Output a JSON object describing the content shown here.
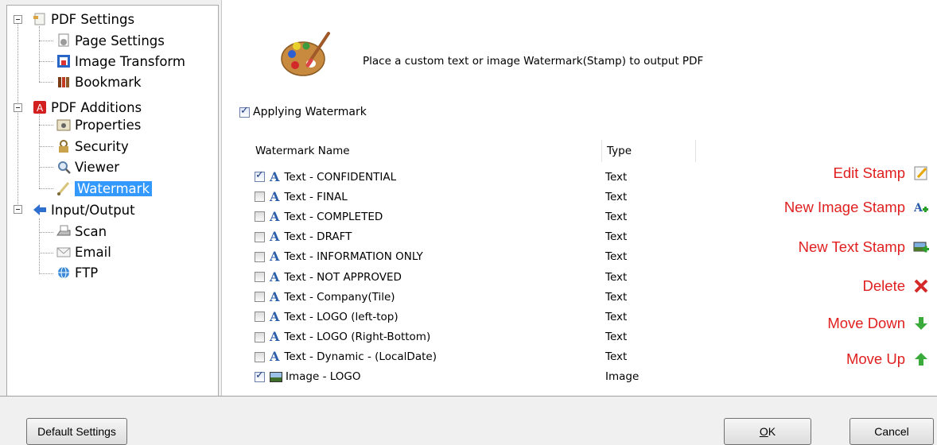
{
  "tree": {
    "items": [
      {
        "label": "PDF Settings",
        "icon": "pdf-settings-icon"
      },
      {
        "label": "Page Settings",
        "icon": "page-settings-icon"
      },
      {
        "label": "Image Transform",
        "icon": "image-transform-icon"
      },
      {
        "label": "Bookmark",
        "icon": "bookmark-icon"
      },
      {
        "label": "PDF Additions",
        "icon": "pdf-additions-icon"
      },
      {
        "label": "Properties",
        "icon": "properties-icon"
      },
      {
        "label": "Security",
        "icon": "security-icon"
      },
      {
        "label": "Viewer",
        "icon": "viewer-icon"
      },
      {
        "label": "Watermark",
        "icon": "watermark-icon",
        "selected": true
      },
      {
        "label": "Input/Output",
        "icon": "input-output-icon"
      },
      {
        "label": "Scan",
        "icon": "scan-icon"
      },
      {
        "label": "Email",
        "icon": "email-icon"
      },
      {
        "label": "FTP",
        "icon": "ftp-icon"
      }
    ]
  },
  "header": {
    "description": "Place a custom text or image Watermark(Stamp) to output PDF"
  },
  "apply": {
    "label": "Applying Watermark",
    "checked": true
  },
  "table": {
    "columns": [
      "Watermark Name",
      "Type"
    ],
    "rows": [
      {
        "name": "Text - CONFIDENTIAL",
        "type": "Text",
        "checked": true,
        "kind": "text"
      },
      {
        "name": "Text - FINAL",
        "type": "Text",
        "checked": false,
        "kind": "text"
      },
      {
        "name": "Text - COMPLETED",
        "type": "Text",
        "checked": false,
        "kind": "text"
      },
      {
        "name": "Text - DRAFT",
        "type": "Text",
        "checked": false,
        "kind": "text"
      },
      {
        "name": "Text - INFORMATION ONLY",
        "type": "Text",
        "checked": false,
        "kind": "text"
      },
      {
        "name": "Text - NOT APPROVED",
        "type": "Text",
        "checked": false,
        "kind": "text"
      },
      {
        "name": "Text - Company(Tile)",
        "type": "Text",
        "checked": false,
        "kind": "text"
      },
      {
        "name": "Text - LOGO (left-top)",
        "type": "Text",
        "checked": false,
        "kind": "text"
      },
      {
        "name": "Text - LOGO (Right-Bottom)",
        "type": "Text",
        "checked": false,
        "kind": "text"
      },
      {
        "name": "Text - Dynamic - (LocalDate)",
        "type": "Text",
        "checked": false,
        "kind": "text"
      },
      {
        "name": "Image - LOGO",
        "type": "Image",
        "checked": true,
        "kind": "image"
      }
    ]
  },
  "actions": {
    "edit": "Edit Stamp",
    "new_image": "New Image Stamp",
    "new_text": "New Text Stamp",
    "delete": "Delete",
    "move_down": "Move Down",
    "move_up": "Move Up"
  },
  "buttons": {
    "default": "Default Settings",
    "ok_u": "O",
    "ok_rest": "K",
    "cancel": "Cancel"
  },
  "colors": {
    "action_text": "#e02020",
    "selection": "#3399ff"
  }
}
